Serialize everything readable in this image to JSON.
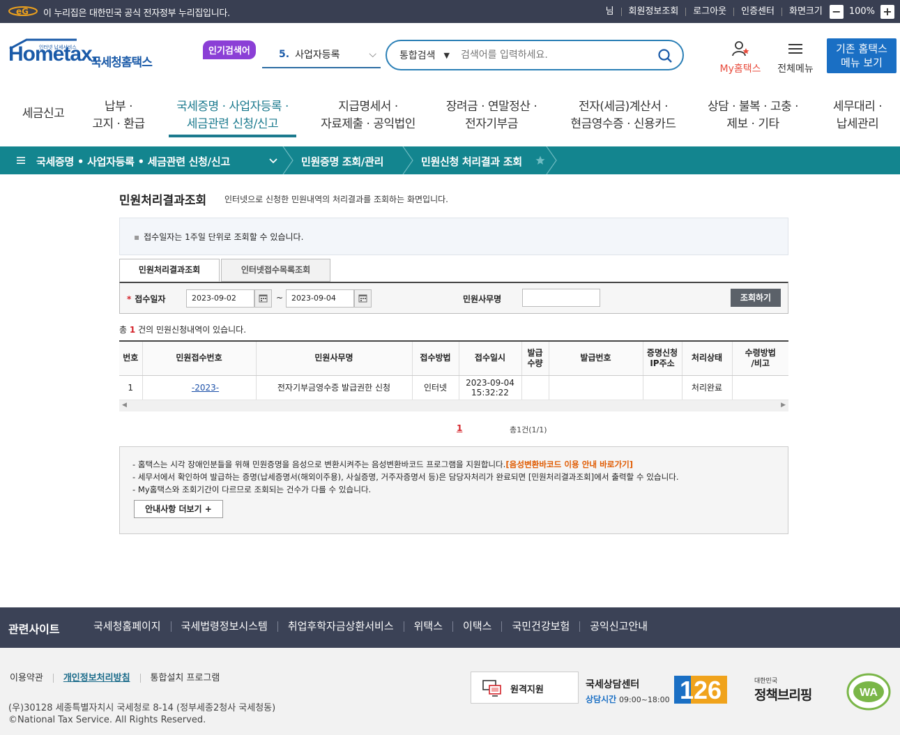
{
  "gov": {
    "text": "이 누리집은 대한민국 공식 전자정부 누리집입니다.",
    "util": [
      "님",
      "회원정보조회",
      "로그아웃",
      "인증센터",
      "화면크기"
    ],
    "zoom": "100%"
  },
  "header": {
    "logo_small": "인터넷 납세서비스",
    "logo_brand": "Hometax.",
    "logo_name": "국세청홈택스",
    "popular_badge": "인기검색어",
    "popular_num": "5.",
    "popular_term": "사업자등록",
    "search_category": "통합검색",
    "search_placeholder": "검색어를 입력하세요.",
    "my_hometax": "My홈택스",
    "all_menu": "전체메뉴",
    "old_menu_1": "기존 홈택스",
    "old_menu_2": "메뉴 보기"
  },
  "gnb": [
    {
      "l1": "세금신고",
      "l2": ""
    },
    {
      "l1": "납부 ·",
      "l2": "고지 · 환급"
    },
    {
      "l1": "국세증명 · 사업자등록 ·",
      "l2": "세금관련 신청/신고"
    },
    {
      "l1": "지급명세서 ·",
      "l2": "자료제출 · 공익법인"
    },
    {
      "l1": "장려금 · 연말정산 ·",
      "l2": "전자기부금"
    },
    {
      "l1": "전자(세금)계산서 ·",
      "l2": "현금영수증 · 신용카드"
    },
    {
      "l1": "상담 · 불복 · 고충 ·",
      "l2": "제보 · 기타"
    },
    {
      "l1": "세무대리 ·",
      "l2": "납세관리"
    }
  ],
  "path": [
    "국세증명 • 사업자등록 • 세금관련 신청/신고",
    "민원증명 조회/관리",
    "민원신청 처리결과 조회"
  ],
  "page": {
    "title": "민원처리결과조회",
    "desc": "인터넷으로 신청한 민원내역의 처리결과를 조회하는 화면입니다.",
    "info": "접수일자는 1주일 단위로 조회할 수 있습니다.",
    "tabs": [
      "민원처리결과조회",
      "인터넷접수목록조회"
    ],
    "search": {
      "date_label": "접수일자",
      "date_from": "2023-09-02",
      "date_to": "2023-09-04",
      "tilde": "~",
      "name_label": "민원사무명",
      "button": "조회하기"
    },
    "count_pre": "총",
    "count_num": "1",
    "count_post": "건의 민원신청내역이 있습니다.",
    "columns": [
      "번호",
      "민원접수번호",
      "민원사무명",
      "접수방법",
      "접수일시",
      "발급\n수량",
      "발급번호",
      "증명신청\nIP주소",
      "처리상태",
      "수령방법\n/비고"
    ],
    "rows": [
      {
        "no": "1",
        "receipt": "-2023-",
        "name": "전자기부금영수증 발급권한 신청",
        "method": "인터넷",
        "date": "2023-09-04",
        "time": "15:32:22",
        "qty": "",
        "issue_no": "",
        "ip": "",
        "status": "처리완료",
        "note": ""
      }
    ],
    "pager_current": "1",
    "pager_total": "총1건(1/1)",
    "notes": {
      "n1_pre": "- 홈택스는 시각 장애인분들을 위해 민원증명을 음성으로 변환시켜주는 음성변환바코드 프로그램을 지원합니다.",
      "n1_link": "[음성변환바코드 이용 안내 바로가기]",
      "n2": "- 세무서에서 확인하여 발급하는 증명(납세증명서(해외이주용), 사실증명, 거주자증명서 등)은 담당자처리가 완료되면 [민원처리결과조회]에서 출력할 수 있습니다.",
      "n3": "- My홈택스와 조회기간이 다르므로 조회되는 건수가 다를 수 있습니다.",
      "more": "안내사항 더보기 +"
    }
  },
  "footer": {
    "related_title": "관련사이트",
    "related": [
      "국세청홈페이지",
      "국세법령정보시스템",
      "취업후학자금상환서비스",
      "위택스",
      "이택스",
      "국민건강보험",
      "공익신고안내"
    ],
    "links": [
      "이용약관",
      "개인정보처리방침",
      "통합설치 프로그램"
    ],
    "address": "(우)30128 세종특별자치시 국세청로 8-14 (정부세종2청사 국세청동)",
    "copyright": "©National Tax Service. All Rights Reserved.",
    "remote": "원격지원",
    "center": "국세상담센터",
    "hours_label": "상담시간",
    "hours": "09:00~18:00",
    "center_num": "126",
    "brief_small": "대한민국",
    "brief": "정책브리핑",
    "wa": "WA"
  },
  "colors": {
    "teal": "#13858f",
    "navy": "#393f52",
    "blue": "#1a6fc4",
    "red": "#d4232a"
  }
}
